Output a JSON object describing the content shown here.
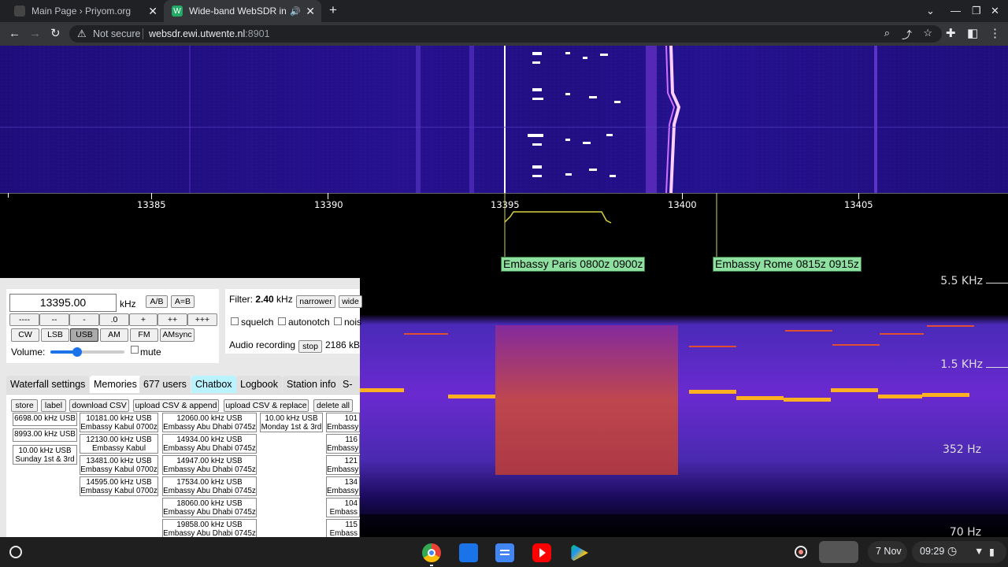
{
  "browser": {
    "tabs": [
      {
        "title": "Main Page › Priyom.org",
        "close": "✕"
      },
      {
        "title": "Wide-band WebSDR in Ensch",
        "close": "✕"
      }
    ],
    "new_tab": "+",
    "url_warning": "Not secure",
    "url_host": "websdr.ewi.utwente.nl",
    "url_port": ":8901"
  },
  "scale": {
    "ticks": [
      "13385",
      "13390",
      "13395",
      "13400",
      "13405"
    ],
    "labels": [
      "Embassy Paris 0800z 0900z",
      "Embassy Rome 0815z 0915z"
    ]
  },
  "spectrogram": {
    "hz_labels": [
      "5.5 KHz",
      "1.5 KHz",
      "352 Hz",
      "70 Hz"
    ]
  },
  "controls": {
    "frequency": "13395.00",
    "unit": "kHz",
    "ab": "A/B",
    "aeqb": "A=B",
    "step_buttons": [
      "----",
      "--",
      "-",
      ".0",
      "+",
      "++",
      "+++"
    ],
    "modes": [
      "CW",
      "LSB",
      "USB",
      "AM",
      "FM",
      "AMsync"
    ],
    "volume_label": "Volume:",
    "mute": "mute",
    "filter_label": "Filter:",
    "filter_value": "2.40",
    "filter_unit": "kHz",
    "narrower": "narrower",
    "wider": "wide",
    "squelch": "squelch",
    "autonotch": "autonotch",
    "noise": "nois",
    "audio_label": "Audio recording",
    "stop": "stop",
    "audio_size": "2186 kB"
  },
  "panel_tabs": [
    "Waterfall settings",
    "Memories",
    "677 users",
    "Chatbox",
    "Logbook",
    "Station info",
    "S-m"
  ],
  "memory_buttons": [
    "store",
    "label",
    "download CSV",
    "upload CSV & append",
    "upload CSV & replace",
    "delete all"
  ],
  "memories": {
    "col1": [
      [
        "6698.00 kHz USB",
        ""
      ],
      [
        "8993.00 kHz USB",
        ""
      ],
      [
        "10.00 kHz USB",
        "Sunday 1st & 3rd"
      ]
    ],
    "col2": [
      [
        "10181.00 kHz USB",
        "Embassy Kabul 0700z"
      ],
      [
        "12130.00 kHz USB",
        "Embassy Kabul"
      ],
      [
        "13481.00 kHz USB",
        "Embassy Kabul 0700z"
      ],
      [
        "14595.00 kHz USB",
        "Embassy Kabul 0700z"
      ]
    ],
    "col3": [
      [
        "12060.00 kHz USB",
        "Embassy Abu Dhabi 0745z"
      ],
      [
        "14934.00 kHz USB",
        "Embassy Abu Dhabi 0745z"
      ],
      [
        "14947.00 kHz USB",
        "Embassy Abu Dhabi 0745z"
      ],
      [
        "17534.00 kHz USB",
        "Embassy Abu Dhabi 0745z"
      ],
      [
        "18060.00 kHz USB",
        "Embassy Abu Dhabi 0745z"
      ],
      [
        "19858.00 kHz USB",
        "Embassy Abu Dhabi 0745z"
      ]
    ],
    "col4": [
      [
        "10.00 kHz USB",
        "Monday 1st & 3rd"
      ]
    ],
    "col5": [
      [
        "101",
        "Embassy"
      ],
      [
        "116",
        "Embassy"
      ],
      [
        "121",
        "Embassy"
      ],
      [
        "134",
        "Embassy"
      ],
      [
        "104",
        "Embass"
      ],
      [
        "115",
        "Embass"
      ]
    ]
  },
  "shelf": {
    "date": "7 Nov",
    "time": "09:29"
  }
}
